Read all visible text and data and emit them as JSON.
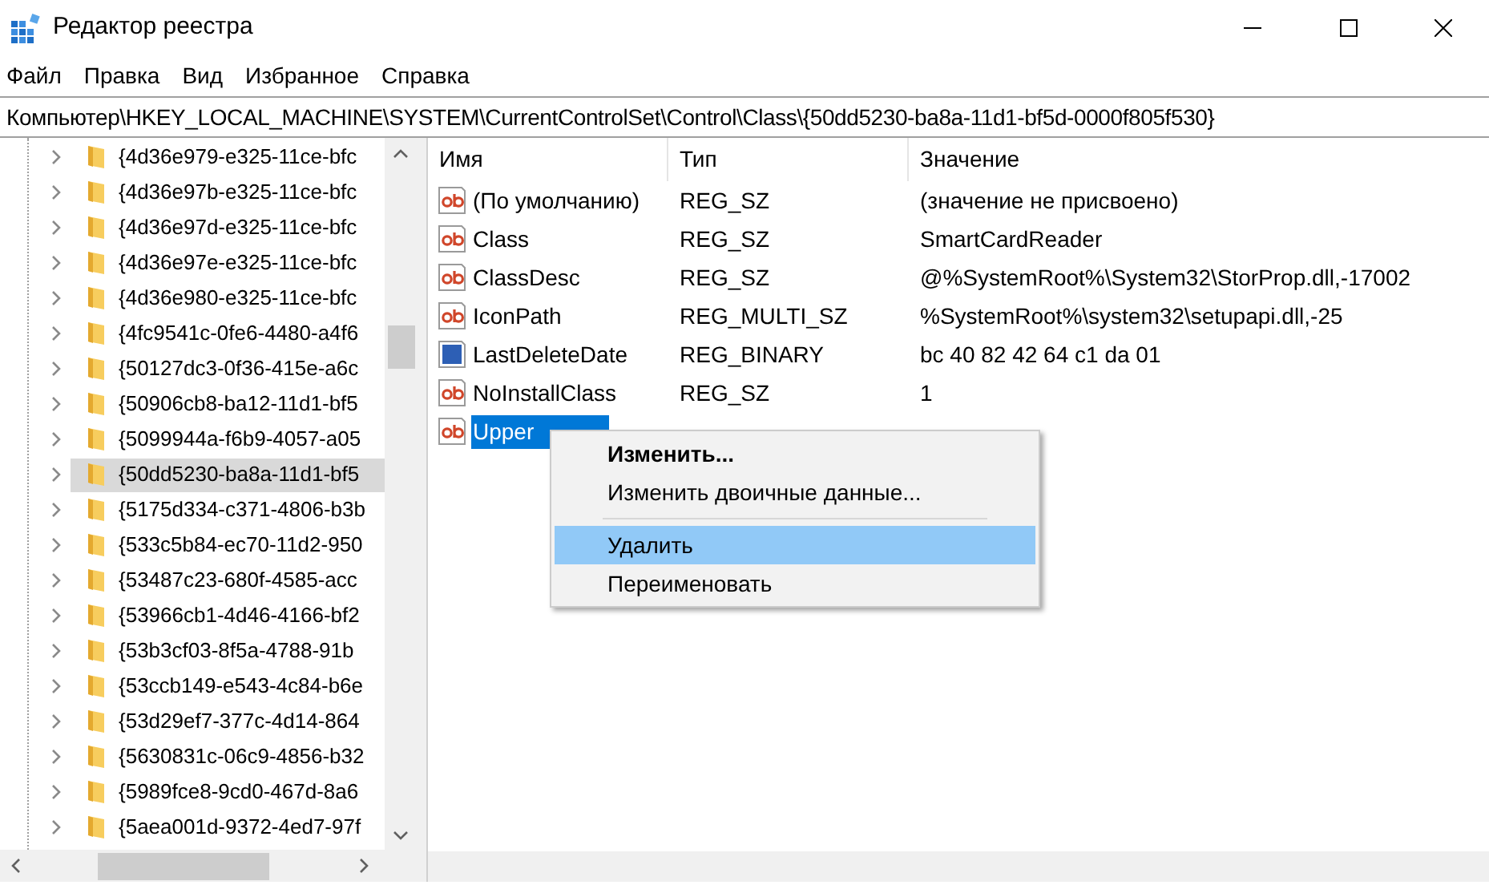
{
  "window": {
    "title": "Редактор реестра"
  },
  "menu_bar": [
    "Файл",
    "Правка",
    "Вид",
    "Избранное",
    "Справка"
  ],
  "address_bar": "Компьютер\\HKEY_LOCAL_MACHINE\\SYSTEM\\CurrentControlSet\\Control\\Class\\{50dd5230-ba8a-11d1-bf5d-0000f805f530}",
  "tree": {
    "items": [
      {
        "label": "{4d36e979-e325-11ce-bfc",
        "selected": false
      },
      {
        "label": "{4d36e97b-e325-11ce-bfc",
        "selected": false
      },
      {
        "label": "{4d36e97d-e325-11ce-bfc",
        "selected": false
      },
      {
        "label": "{4d36e97e-e325-11ce-bfc",
        "selected": false
      },
      {
        "label": "{4d36e980-e325-11ce-bfc",
        "selected": false
      },
      {
        "label": "{4fc9541c-0fe6-4480-a4f6",
        "selected": false
      },
      {
        "label": "{50127dc3-0f36-415e-a6c",
        "selected": false
      },
      {
        "label": "{50906cb8-ba12-11d1-bf5",
        "selected": false
      },
      {
        "label": "{5099944a-f6b9-4057-a05",
        "selected": false
      },
      {
        "label": "{50dd5230-ba8a-11d1-bf5",
        "selected": true
      },
      {
        "label": "{5175d334-c371-4806-b3b",
        "selected": false
      },
      {
        "label": "{533c5b84-ec70-11d2-950",
        "selected": false
      },
      {
        "label": "{53487c23-680f-4585-acc",
        "selected": false
      },
      {
        "label": "{53966cb1-4d46-4166-bf2",
        "selected": false
      },
      {
        "label": "{53b3cf03-8f5a-4788-91b",
        "selected": false
      },
      {
        "label": "{53ccb149-e543-4c84-b6e",
        "selected": false
      },
      {
        "label": "{53d29ef7-377c-4d14-864",
        "selected": false
      },
      {
        "label": "{5630831c-06c9-4856-b32",
        "selected": false
      },
      {
        "label": "{5989fce8-9cd0-467d-8a6",
        "selected": false
      },
      {
        "label": "{5aea001d-9372-4ed7-97f",
        "selected": false
      }
    ]
  },
  "values": {
    "columns": [
      "Имя",
      "Тип",
      "Значение"
    ],
    "rows": [
      {
        "kind": "string",
        "name": "(По умолчанию)",
        "type": "REG_SZ",
        "value": "(значение не присвоено)",
        "selected": false
      },
      {
        "kind": "string",
        "name": "Class",
        "type": "REG_SZ",
        "value": "SmartCardReader",
        "selected": false
      },
      {
        "kind": "string",
        "name": "ClassDesc",
        "type": "REG_SZ",
        "value": "@%SystemRoot%\\System32\\StorProp.dll,-17002",
        "selected": false
      },
      {
        "kind": "string",
        "name": "IconPath",
        "type": "REG_MULTI_SZ",
        "value": "%SystemRoot%\\system32\\setupapi.dll,-25",
        "selected": false
      },
      {
        "kind": "binary",
        "name": "LastDeleteDate",
        "type": "REG_BINARY",
        "value": "bc 40 82 42 64 c1 da 01",
        "selected": false
      },
      {
        "kind": "string",
        "name": "NoInstallClass",
        "type": "REG_SZ",
        "value": "1",
        "selected": false
      },
      {
        "kind": "string",
        "name": "Upper",
        "selected": true
      }
    ]
  },
  "context_menu": [
    {
      "kind": "item",
      "label": "Изменить...",
      "default": true,
      "highlighted": false
    },
    {
      "kind": "item",
      "label": "Изменить двоичные данные...",
      "default": false,
      "highlighted": false
    },
    {
      "kind": "separator"
    },
    {
      "kind": "item",
      "label": "Удалить",
      "default": false,
      "highlighted": true
    },
    {
      "kind": "item",
      "label": "Переименовать",
      "default": false,
      "highlighted": false
    }
  ]
}
